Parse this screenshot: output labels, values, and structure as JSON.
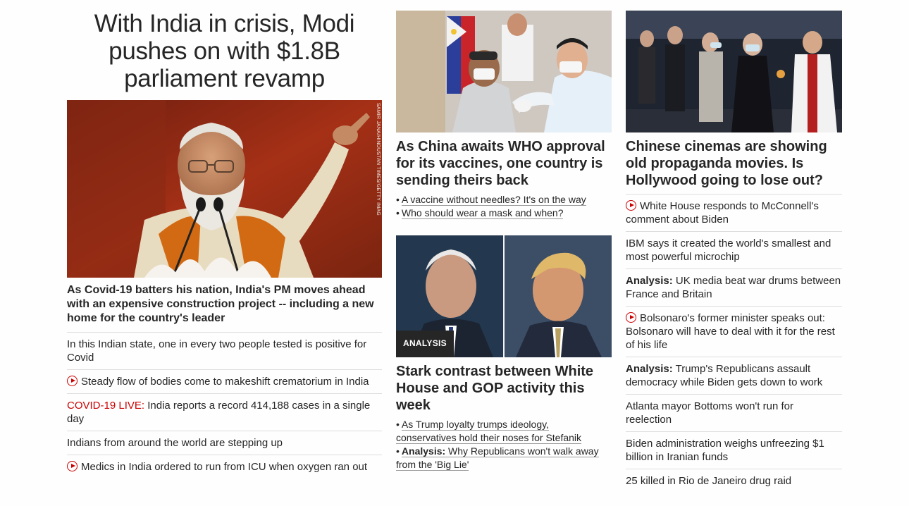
{
  "col1": {
    "headline": "With India in crisis, Modi pushes on with $1.8B parliament revamp",
    "photo_credit": "SAMIR JANA/HINDUSTAN TIMES/GETTY IMAGES",
    "summary": "As Covid-19 batters his nation, India's PM moves ahead with an expensive construction project -- including a new home for the country's leader",
    "links": [
      {
        "text": "In this Indian state, one in every two people tested is positive for Covid",
        "icon": ""
      },
      {
        "text": "Steady flow of bodies come to makeshift crematorium in India",
        "icon": "play-icon"
      },
      {
        "prefix": "COVID-19 LIVE:",
        "text": " India reports a record 414,188 cases in a single day",
        "icon": ""
      },
      {
        "text": "Indians from around the world are stepping up",
        "icon": ""
      },
      {
        "text": "Medics in India ordered to run from ICU when oxygen ran out",
        "icon": "play-icon"
      }
    ]
  },
  "col2": {
    "story1": {
      "title": "As China awaits WHO approval for its vaccines, one country is sending theirs back",
      "links": [
        {
          "text": "A vaccine without needles? It's on the way"
        },
        {
          "text": "Who should wear a mask and when?"
        }
      ]
    },
    "story2": {
      "badge": "ANALYSIS",
      "title": "Stark contrast between White House and GOP activity this week",
      "links": [
        {
          "prefix": "",
          "text": "As Trump loyalty trumps ideology, conservatives hold their noses for Stefanik"
        },
        {
          "prefix": "Analysis:",
          "text": " Why Republicans won't walk away from the 'Big Lie'"
        }
      ]
    }
  },
  "col3": {
    "title": "Chinese cinemas are showing old propaganda movies. Is Hollywood going to lose out?",
    "links": [
      {
        "prefix": "",
        "text": "White House responds to McConnell's comment about Biden",
        "icon": "play-icon"
      },
      {
        "prefix": "",
        "text": "IBM says it created the world's smallest and most powerful microchip",
        "icon": ""
      },
      {
        "prefix": "Analysis:",
        "text": " UK media beat war drums between France and Britain",
        "icon": ""
      },
      {
        "prefix": "",
        "text": "Bolsonaro's former minister speaks out: Bolsonaro will have to deal with it for the rest of his life",
        "icon": "play-icon"
      },
      {
        "prefix": "Analysis:",
        "text": " Trump's Republicans assault democracy while Biden gets down to work",
        "icon": ""
      },
      {
        "prefix": "",
        "text": "Atlanta mayor Bottoms won't run for reelection",
        "icon": ""
      },
      {
        "prefix": "",
        "text": "Biden administration weighs unfreezing $1 billion in Iranian funds",
        "icon": ""
      },
      {
        "prefix": "",
        "text": "25 killed in Rio de Janeiro drug raid",
        "icon": ""
      }
    ]
  },
  "colors": {
    "text": "#262626",
    "accent": "#cc0000",
    "divider": "#dedede",
    "badge": "#262626"
  }
}
